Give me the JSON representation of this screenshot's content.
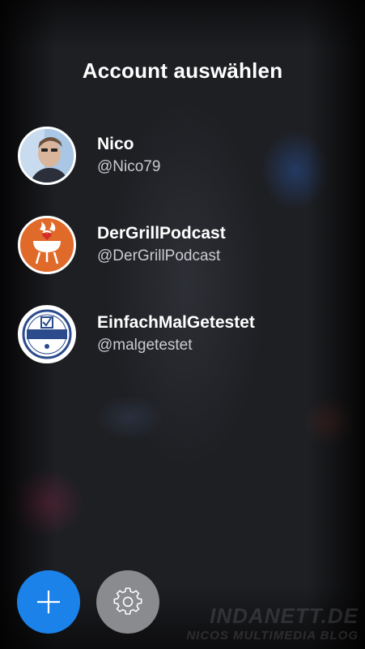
{
  "header": {
    "title": "Account auswählen"
  },
  "accounts": [
    {
      "name": "Nico",
      "handle": "@Nico79",
      "avatar": "person-photo-avatar"
    },
    {
      "name": "DerGrillPodcast",
      "handle": "@DerGrillPodcast",
      "avatar": "grill-heart-logo"
    },
    {
      "name": "EinfachMalGetestet",
      "handle": "@malgetestet",
      "avatar": "einfach-mal-getestet-seal"
    }
  ],
  "actions": {
    "add": {
      "icon": "plus-icon",
      "color": "#1b82ea"
    },
    "settings": {
      "icon": "gear-icon",
      "color": "#8a8b8e"
    }
  },
  "watermark": {
    "line1": "INDANETT.DE",
    "line2": "NICOS MULTIMEDIA BLOG"
  },
  "colors": {
    "accent": "#1b82ea",
    "background": "#1e1f23"
  }
}
